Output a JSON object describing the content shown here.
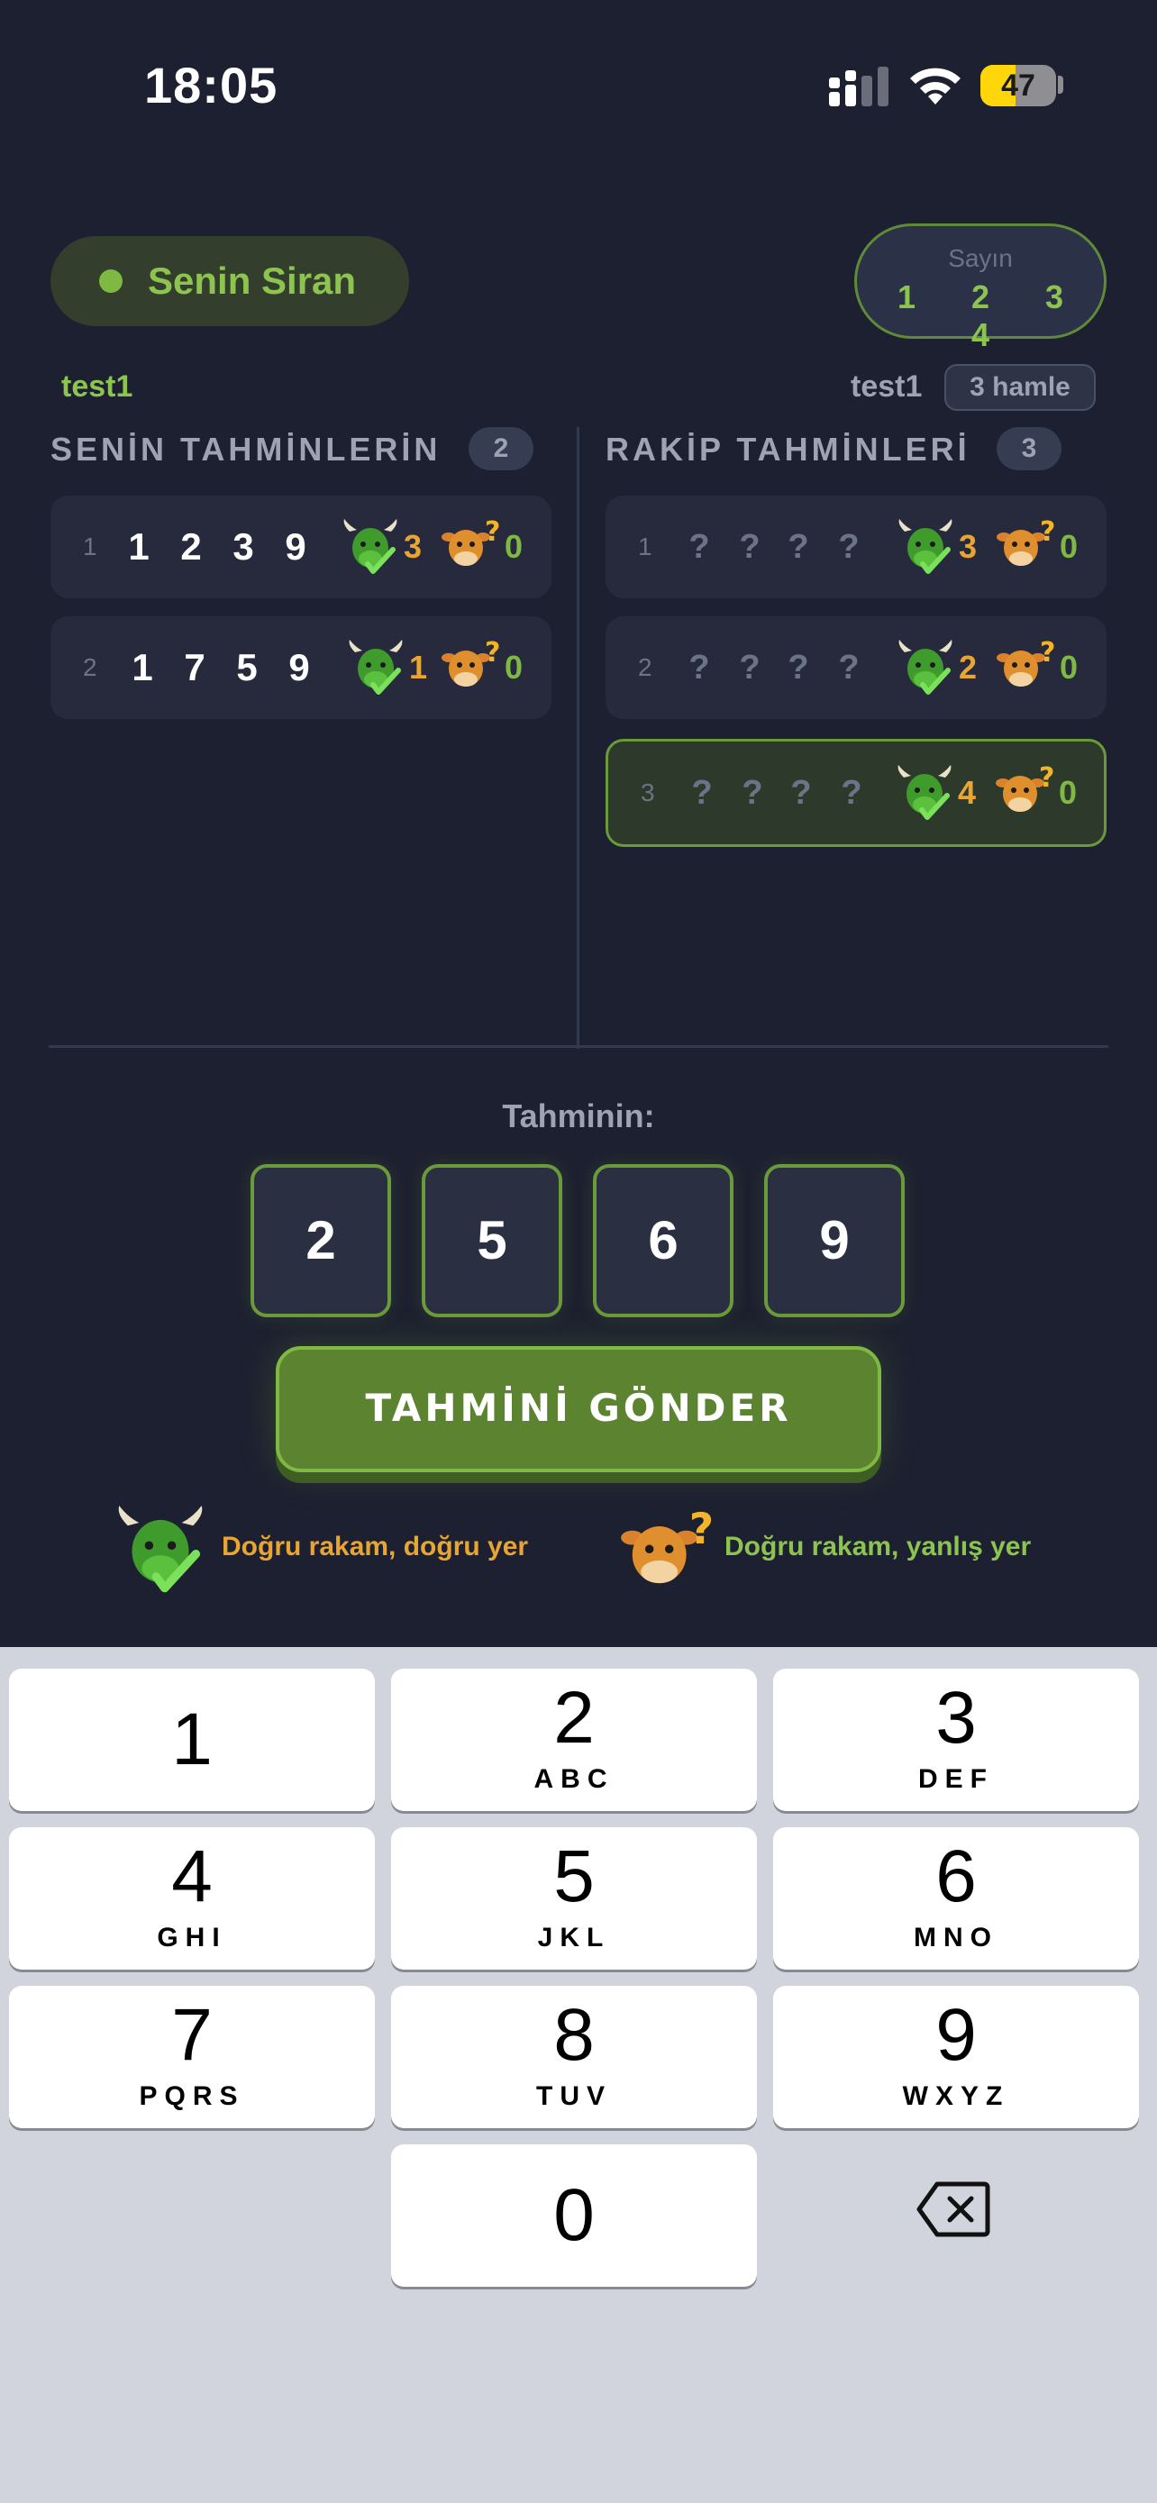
{
  "status_bar": {
    "time": "18:05",
    "battery": "47",
    "battery_level": 0.47
  },
  "turn": {
    "label": "Senin Siran"
  },
  "secret": {
    "label": "Sayın",
    "digits": "1 2 3 4"
  },
  "players": {
    "me": "test1",
    "opponent": "test1",
    "opponent_moves": "3 hamle"
  },
  "my_guesses": {
    "header": "SENİN TAHMİNLERİN",
    "count": "2",
    "rows": [
      {
        "index": "1",
        "digits": [
          "1",
          "2",
          "3",
          "9"
        ],
        "bulls": "3",
        "cows": "0"
      },
      {
        "index": "2",
        "digits": [
          "1",
          "7",
          "5",
          "9"
        ],
        "bulls": "1",
        "cows": "0"
      }
    ]
  },
  "opponent_guesses": {
    "header": "RAKİP TAHMİNLERİ",
    "count": "3",
    "rows": [
      {
        "index": "1",
        "digits": [
          "?",
          "?",
          "?",
          "?"
        ],
        "bulls": "3",
        "cows": "0"
      },
      {
        "index": "2",
        "digits": [
          "?",
          "?",
          "?",
          "?"
        ],
        "bulls": "2",
        "cows": "0"
      },
      {
        "index": "3",
        "digits": [
          "?",
          "?",
          "?",
          "?"
        ],
        "bulls": "4",
        "cows": "0"
      }
    ]
  },
  "guess_input": {
    "label": "Tahminin:",
    "digits": [
      "2",
      "5",
      "6",
      "9"
    ]
  },
  "submit": {
    "label": "TAHMİNİ GÖNDER"
  },
  "legend": {
    "bull": {
      "icon": "bull-icon",
      "text": "Doğru rakam, doğru yer"
    },
    "cow": {
      "icon": "cow-icon",
      "text": "Doğru rakam, yanlış yer"
    }
  },
  "keypad": {
    "keys": [
      {
        "num": "1",
        "letters": ""
      },
      {
        "num": "2",
        "letters": "ABC"
      },
      {
        "num": "3",
        "letters": "DEF"
      },
      {
        "num": "4",
        "letters": "GHI"
      },
      {
        "num": "5",
        "letters": "JKL"
      },
      {
        "num": "6",
        "letters": "MNO"
      },
      {
        "num": "7",
        "letters": "PQRS"
      },
      {
        "num": "8",
        "letters": "TUV"
      },
      {
        "num": "9",
        "letters": "WXYZ"
      },
      {
        "num": "0",
        "letters": ""
      }
    ],
    "backspace_icon": "backspace-icon"
  },
  "colors": {
    "background": "#1d2030",
    "accent_green": "#8cc44f",
    "accent_orange": "#e8a531",
    "keypad_bg": "#d1d4dc"
  }
}
